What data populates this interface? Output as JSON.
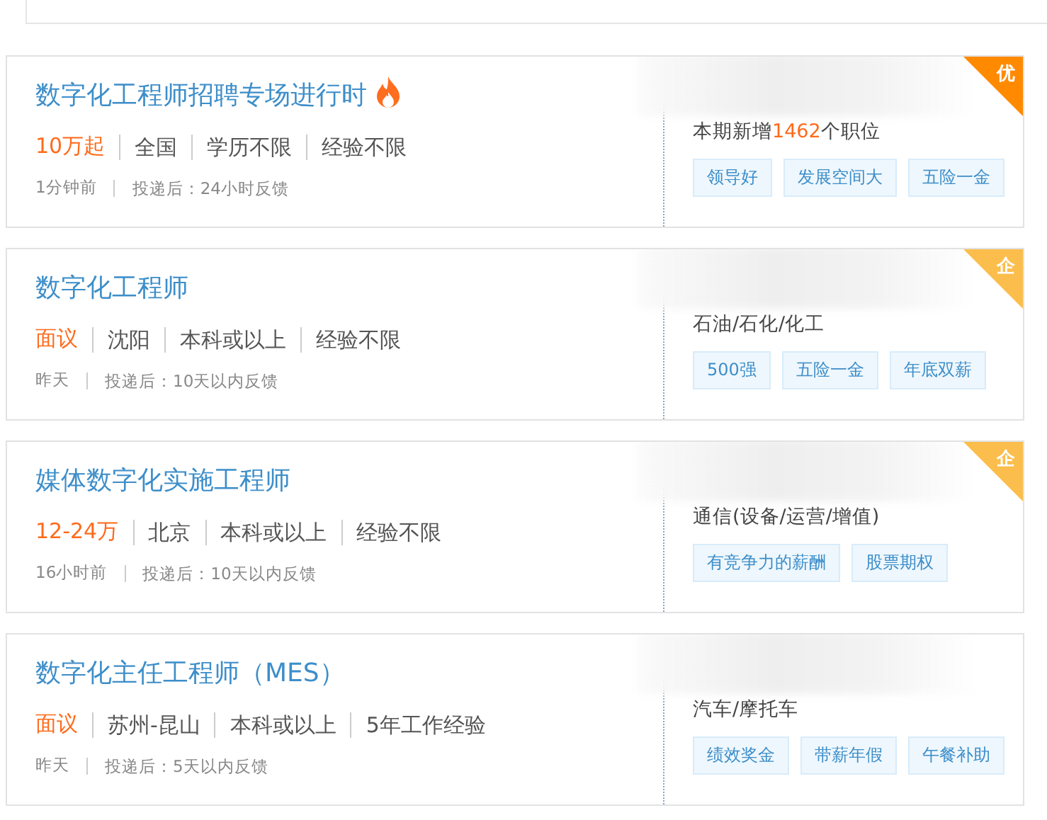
{
  "jobs": [
    {
      "title": "数字化工程师招聘专场进行时",
      "hot": true,
      "salary": "10万起",
      "meta": [
        "全国",
        "学历不限",
        "经验不限"
      ],
      "posted": "1分钟前",
      "feedback": "投递后：24小时反馈",
      "badge": {
        "kind": "excellent",
        "label": "优"
      },
      "industry": {
        "before": "本期新增",
        "count": "1462",
        "after": "个职位"
      },
      "tags": [
        "领导好",
        "发展空间大",
        "五险一金"
      ]
    },
    {
      "title": "数字化工程师",
      "hot": false,
      "salary": "面议",
      "meta": [
        "沈阳",
        "本科或以上",
        "经验不限"
      ],
      "posted": "昨天",
      "feedback": "投递后：10天以内反馈",
      "badge": {
        "kind": "enterprise",
        "label": "企"
      },
      "industry": {
        "before": "石油/石化/化工"
      },
      "tags": [
        "500强",
        "五险一金",
        "年底双薪"
      ]
    },
    {
      "title": "媒体数字化实施工程师",
      "hot": false,
      "salary": "12-24万",
      "meta": [
        "北京",
        "本科或以上",
        "经验不限"
      ],
      "posted": "16小时前",
      "feedback": "投递后：10天以内反馈",
      "badge": {
        "kind": "enterprise",
        "label": "企"
      },
      "industry": {
        "before": "通信(设备/运营/增值)"
      },
      "tags": [
        "有竞争力的薪酬",
        "股票期权"
      ]
    },
    {
      "title": "数字化主任工程师（MES）",
      "hot": false,
      "salary": "面议",
      "meta": [
        "苏州-昆山",
        "本科或以上",
        "5年工作经验"
      ],
      "posted": "昨天",
      "feedback": "投递后：5天以内反馈",
      "industry": {
        "before": "汽车/摩托车"
      },
      "tags": [
        "绩效奖金",
        "带薪年假",
        "午餐补助"
      ]
    }
  ]
}
